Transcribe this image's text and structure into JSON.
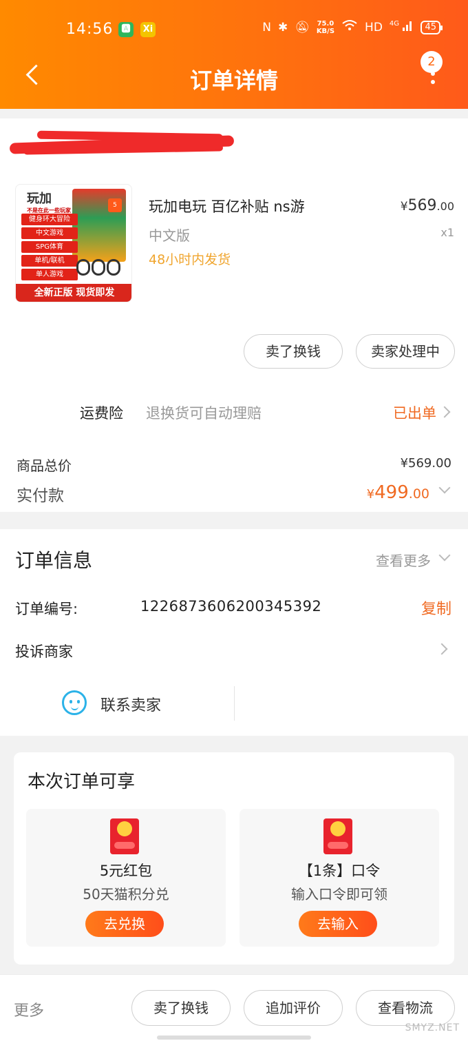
{
  "status_bar": {
    "time": "14:56",
    "app_badge_1": "🅰",
    "app_badge_2": "Xi",
    "net_speed": "75.0",
    "net_unit": "KB/S",
    "hd": "HD",
    "signal": "4G",
    "battery": "45"
  },
  "nav": {
    "title": "订单详情",
    "message_count": "2"
  },
  "product": {
    "thumb": {
      "brand": "玩加",
      "brand_sub": "不是在此一些玩家",
      "box_badge": "5",
      "tags": [
        "健身环大冒险",
        "中文游戏",
        "SPG体育",
        "单机/联机",
        "单人游戏"
      ],
      "footer": "全新正版 现货即发"
    },
    "title": "玩加电玩 百亿补贴 ns游",
    "variant": "中文版",
    "shipping": "48小时内发货",
    "price_yen": "¥",
    "price_int": "569",
    "price_cents": ".00",
    "quantity": "x1"
  },
  "actions": {
    "sell_for_cash": "卖了换钱",
    "seller_processing": "卖家处理中"
  },
  "insurance": {
    "label": "运费险",
    "desc": "退换货可自动理赔",
    "status": "已出单"
  },
  "summary": {
    "total_label": "商品总价",
    "total_value": "¥569.00",
    "paid_label": "实付款",
    "paid_yen": "¥",
    "paid_int": "499",
    "paid_cents": ".00"
  },
  "order_info": {
    "title": "订单信息",
    "view_more": "查看更多",
    "order_no_label": "订单编号:",
    "order_no": "1226873606200345392",
    "copy": "复制",
    "complain": "投诉商家",
    "contact_seller": "联系卖家"
  },
  "benefits": {
    "title": "本次订单可享",
    "items": [
      {
        "name": "5元红包",
        "desc": "50天猫积分兑",
        "button": "去兑换"
      },
      {
        "name": "【1条】口令",
        "desc": "输入口令即可领",
        "button": "去输入"
      }
    ]
  },
  "bottom_bar": {
    "more": "更多",
    "sell_for_cash": "卖了换钱",
    "add_review": "追加评价",
    "view_logistics": "查看物流"
  },
  "watermark": "SMYZ.NET",
  "colors": {
    "header_start": "#ff8a00",
    "header_end": "#ff5a1a",
    "accent": "#f06a22",
    "shipping_note": "#f0a52e"
  }
}
